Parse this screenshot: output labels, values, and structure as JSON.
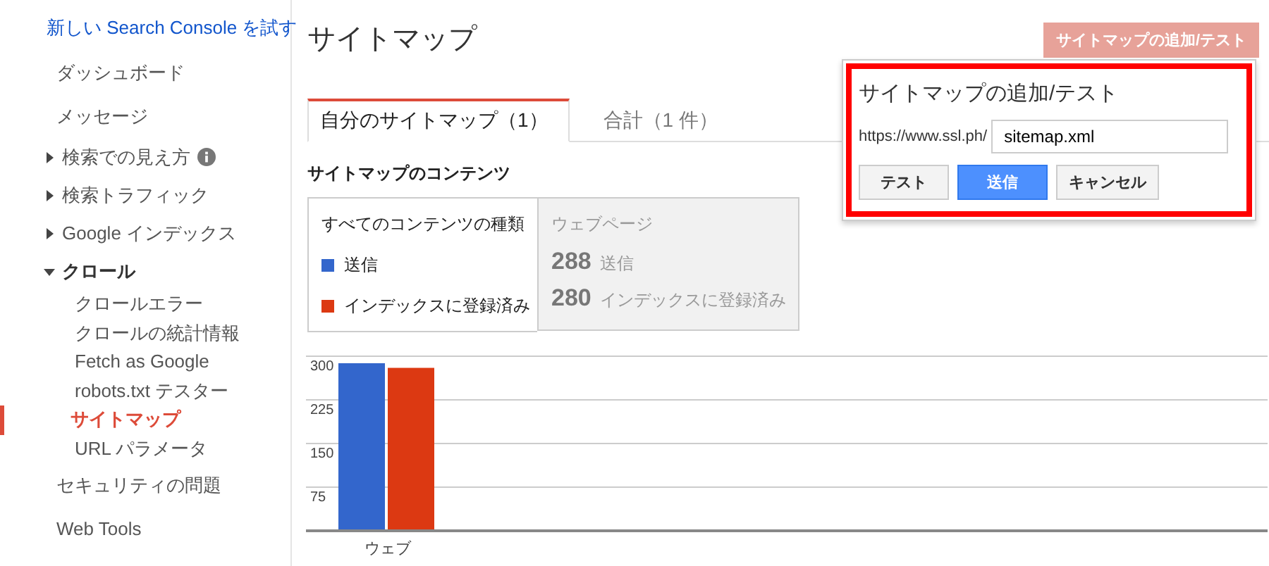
{
  "sidebar": {
    "link": {
      "label": "新しい Search Console を試す"
    },
    "items": [
      {
        "label": "ダッシュボード",
        "kind": "item",
        "selected": false
      },
      {
        "label": "メッセージ",
        "kind": "item",
        "selected": false
      },
      {
        "label": "検索での見え方",
        "kind": "group",
        "expanded": false,
        "info": true,
        "selected": false
      },
      {
        "label": "検索トラフィック",
        "kind": "group",
        "expanded": false,
        "info": false,
        "selected": false
      },
      {
        "label": "Google インデックス",
        "kind": "group",
        "expanded": false,
        "info": false,
        "selected": false
      },
      {
        "label": "クロール",
        "kind": "group",
        "expanded": true,
        "info": false,
        "selected": false,
        "children": [
          {
            "label": "クロールエラー",
            "selected": false
          },
          {
            "label": "クロールの統計情報",
            "selected": false
          },
          {
            "label": "Fetch as Google",
            "selected": false
          },
          {
            "label": "robots.txt テスター",
            "selected": false
          },
          {
            "label": "サイトマップ",
            "selected": true
          },
          {
            "label": "URL パラメータ",
            "selected": false
          }
        ]
      },
      {
        "label": "セキュリティの問題",
        "kind": "item",
        "selected": false
      },
      {
        "label": "Web Tools",
        "kind": "item",
        "selected": false
      }
    ]
  },
  "page": {
    "title": "サイトマップ",
    "add_button": {
      "label": "サイトマップの追加/テスト",
      "disabled": true
    },
    "tabs": [
      {
        "label": "自分のサイトマップ（1）",
        "selected": true
      },
      {
        "label": "合計（1 件）",
        "selected": false
      }
    ],
    "contents": {
      "heading": "サイトマップのコンテンツ",
      "types_header": "すべてのコンテンツの種類",
      "legend": [
        {
          "label": "送信",
          "color": "#3366cc"
        },
        {
          "label": "インデックスに登録済み",
          "color": "#dc3912"
        }
      ],
      "column_header": "ウェブページ",
      "stats": [
        {
          "value": "288",
          "label": "送信"
        },
        {
          "value": "280",
          "label": "インデックスに登録済み"
        }
      ]
    },
    "chart_data": {
      "type": "bar",
      "categories": [
        "ウェブ"
      ],
      "series": [
        {
          "color": "#3366cc",
          "values": [
            288
          ]
        },
        {
          "color": "#dc3912",
          "values": [
            280
          ]
        }
      ],
      "ylim": [
        0,
        300
      ],
      "yticks": [
        75,
        150,
        225,
        300
      ],
      "grid": true
    }
  },
  "dialog": {
    "title": "サイトマップの追加/テスト",
    "highlighted": true,
    "prefix": "https://www.ssl.ph/",
    "value": "sitemap.xml",
    "buttons": [
      {
        "label": "テスト",
        "kind": "default"
      },
      {
        "label": "送信",
        "kind": "primary"
      },
      {
        "label": "キャンセル",
        "kind": "default"
      }
    ]
  }
}
